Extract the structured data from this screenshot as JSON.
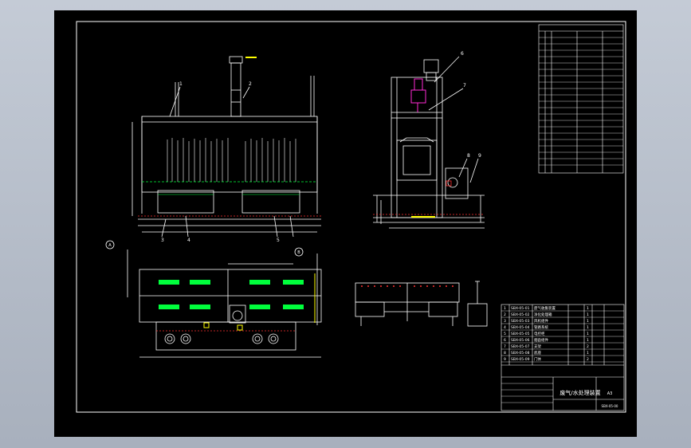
{
  "drawing": {
    "title_block": {
      "rows": [
        {
          "code": "SBX-05-01",
          "part": "废气收集装置",
          "qty": "1"
        },
        {
          "code": "SBX-05-02",
          "part": "净化处理箱",
          "qty": "1"
        },
        {
          "code": "SBX-05-03",
          "part": "风机组件",
          "qty": "1"
        },
        {
          "code": "SBX-05-04",
          "part": "管路系统",
          "qty": "1"
        },
        {
          "code": "SBX-05-05",
          "part": "电控柜",
          "qty": "1"
        },
        {
          "code": "SBX-05-06",
          "part": "烟囱组件",
          "qty": "1"
        },
        {
          "code": "SBX-05-07",
          "part": "支架",
          "qty": "2"
        },
        {
          "code": "SBX-05-08",
          "part": "底座",
          "qty": "1"
        },
        {
          "code": "SBX-05-09",
          "part": "门体",
          "qty": "2"
        }
      ],
      "drawing_title": "废气/水处理装置",
      "sheet_size": "A3",
      "drawing_number": "SBX-05-00"
    },
    "callouts": [
      "1",
      "2",
      "3",
      "4",
      "5",
      "6",
      "7",
      "8",
      "9",
      "A",
      "B"
    ],
    "views": [
      "front-view",
      "side-view",
      "plan-view",
      "detail-a",
      "detail-b"
    ],
    "colors": {
      "sheet": "#000000",
      "line": "#ffffff",
      "accent_green": "#00ff3c",
      "accent_red": "#ff3030",
      "accent_magenta": "#ff2ad4",
      "accent_yellow": "#ffff00",
      "dim_line": "#ffffff"
    }
  }
}
